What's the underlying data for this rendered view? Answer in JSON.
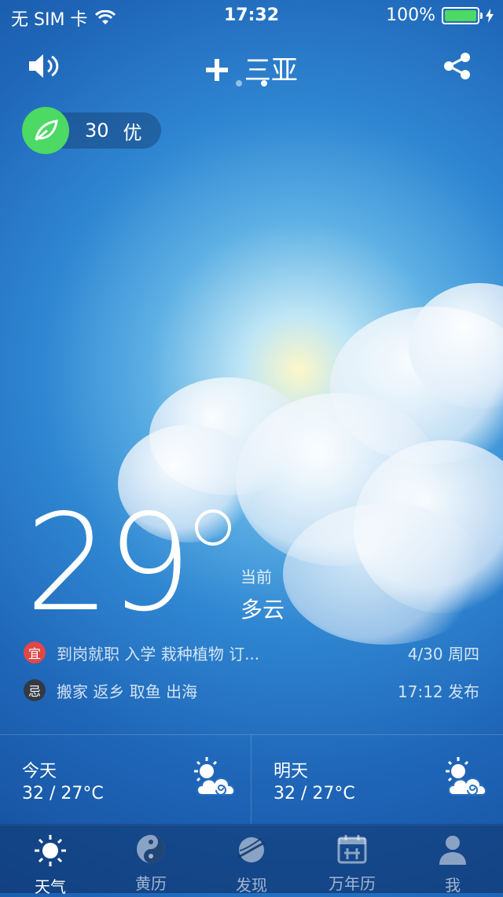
{
  "status_bar": {
    "carrier": "无 SIM 卡",
    "time": "17:32",
    "battery": "100%",
    "battery_level": 1.0
  },
  "header": {
    "city": "三亚",
    "add_icon": "plus-icon",
    "sound_icon": "speaker-icon",
    "share_icon": "share-icon",
    "page_dots": 2,
    "active_page": 1
  },
  "aqi": {
    "value": "30",
    "level": "优",
    "icon": "leaf-icon",
    "color": "#4cd964"
  },
  "current": {
    "temperature": "29",
    "label": "当前",
    "condition": "多云"
  },
  "almanac": {
    "yi_badge": "宜",
    "yi_text": "到岗就职 入学 栽种植物 订...",
    "date": "4/30 周四",
    "ji_badge": "忌",
    "ji_text": "搬家 返乡 取鱼 出海",
    "published": "17:12 发布"
  },
  "forecast": [
    {
      "title": "今天",
      "temps": "32 / 27°C",
      "icon": "partly-cloudy-icon"
    },
    {
      "title": "明天",
      "temps": "32 / 27°C",
      "icon": "partly-cloudy-icon"
    }
  ],
  "tabs": [
    {
      "label": "天气",
      "icon": "sun-icon",
      "active": true
    },
    {
      "label": "黄历",
      "icon": "yin-yang-icon",
      "active": false
    },
    {
      "label": "发现",
      "icon": "planet-icon",
      "active": false
    },
    {
      "label": "万年历",
      "icon": "calendar-icon",
      "active": false
    },
    {
      "label": "我",
      "icon": "user-icon",
      "active": false
    }
  ]
}
